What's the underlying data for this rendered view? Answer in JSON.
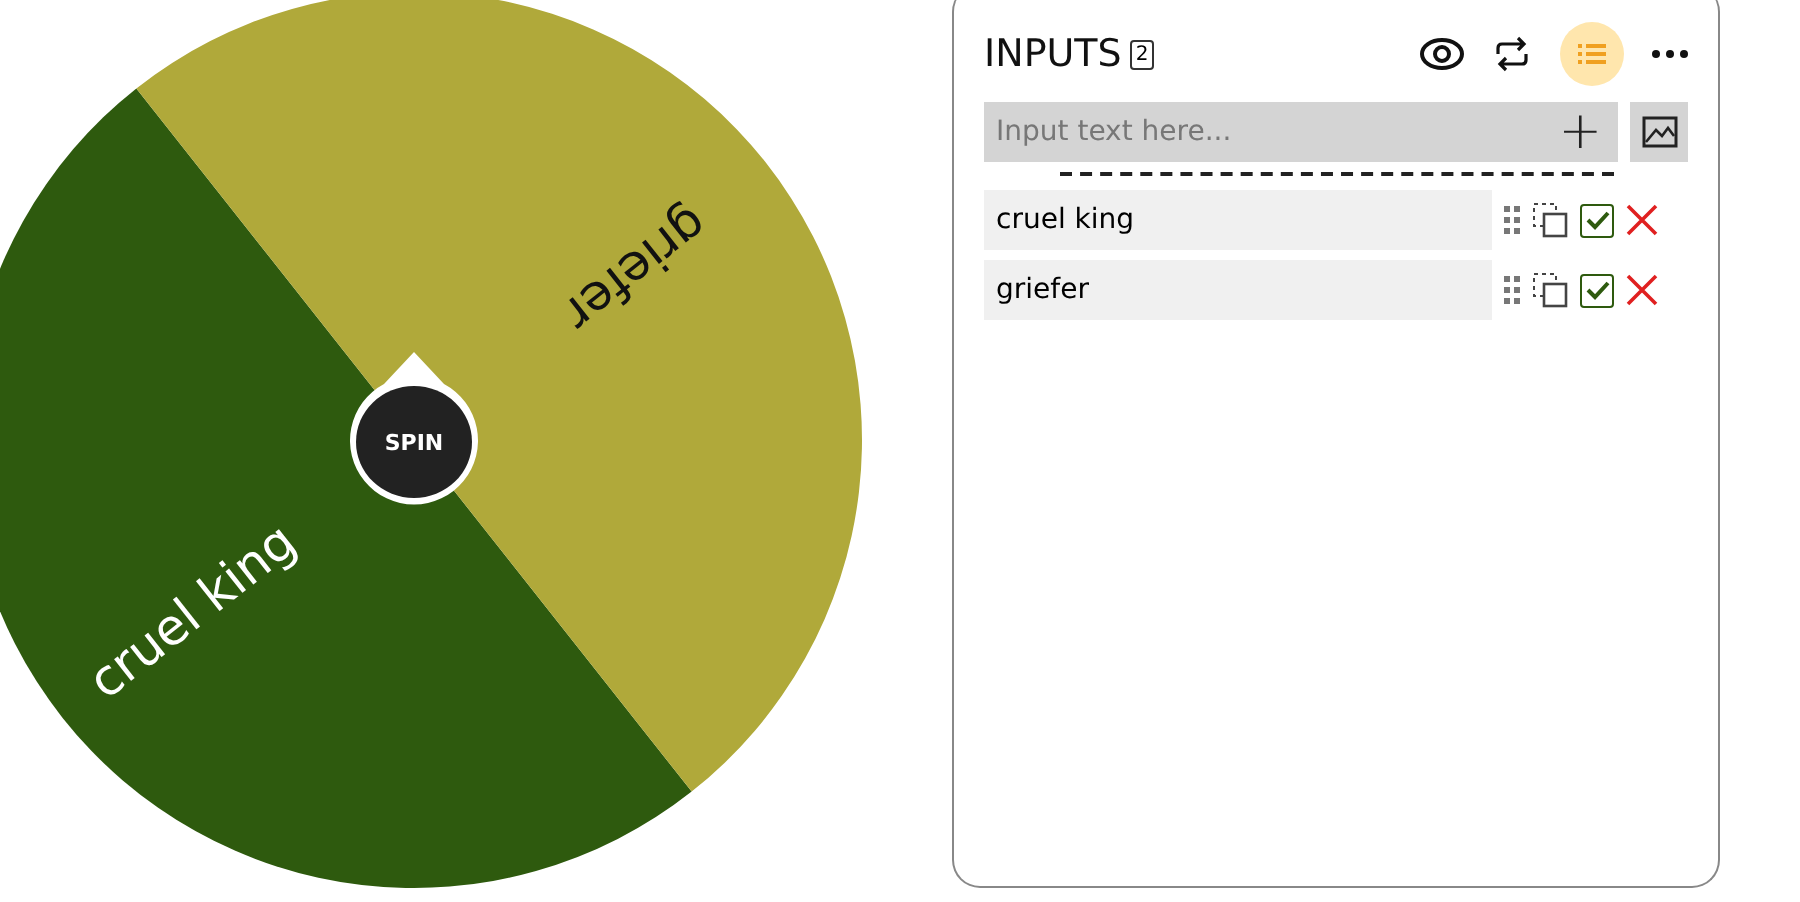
{
  "wheel": {
    "button": "SPIN",
    "slices": [
      {
        "label": "cruel king",
        "color": "#2e5a0e"
      },
      {
        "label": "griefer",
        "color": "#b0a93a"
      }
    ]
  },
  "panel": {
    "title": "INPUTS",
    "count": "2",
    "list_view_selected": true,
    "input": {
      "placeholder": "Input text here...",
      "add": "+"
    },
    "entries": [
      {
        "text": "cruel king",
        "checked": true
      },
      {
        "text": "griefer",
        "checked": true
      }
    ]
  }
}
